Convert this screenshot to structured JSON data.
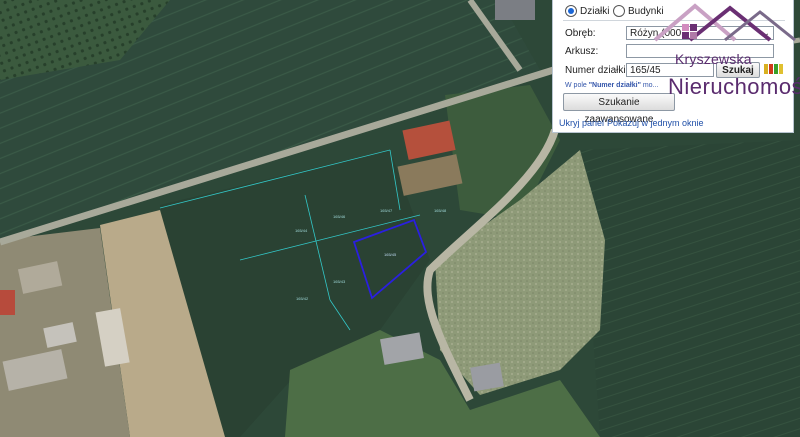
{
  "search": {
    "radio_dzialki": "Działki",
    "radio_budynki": "Budynki",
    "obreb_label": "Obręb:",
    "obreb_value": "Różyn (000",
    "arkusz_label": "Arkusz:",
    "arkusz_value": "",
    "numer_label": "Numer działki:",
    "numer_value": "165/45",
    "szukaj_button": "Szukaj",
    "hint_prefix": "W pole ",
    "hint_bold": "\"Numer działki\"",
    "hint_suffix": " mo...",
    "advanced_button": "Szukanie zaawansowane",
    "hide_link": "Ukryj panel",
    "show_link": "Pokazuj w jednym oknie",
    "selected_type": "Działki"
  },
  "logo": {
    "line1": "Kryszewska",
    "line2": "Nieruchomości",
    "color": "#5a2b6e"
  },
  "map": {
    "type": "aerial orthophoto with cadastral parcels",
    "highlight_color": "#2a1fe0",
    "parcel_line_color": "#33c7c7",
    "parcel_labels": [
      "165/45"
    ]
  }
}
